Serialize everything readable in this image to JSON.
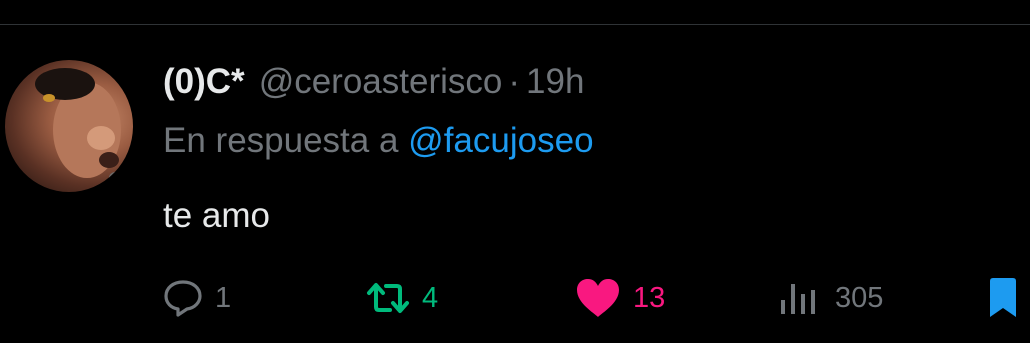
{
  "tweet": {
    "author": {
      "display_name": "(0)C*",
      "handle": "@ceroasterisco",
      "avatar_icon": "profile-photo"
    },
    "separator": "·",
    "time": "19h",
    "reply_to": {
      "prefix": "En respuesta a",
      "mention": "@facujoseo"
    },
    "text": "te amo",
    "actions": {
      "reply": {
        "icon": "reply-bubble-icon",
        "count": "1"
      },
      "retweet": {
        "icon": "retweet-icon",
        "count": "4",
        "active": true
      },
      "like": {
        "icon": "heart-icon",
        "count": "13",
        "active": true
      },
      "views": {
        "icon": "views-bars-icon",
        "count": "305"
      },
      "bookmark": {
        "icon": "bookmark-icon",
        "active": true
      }
    }
  },
  "colors": {
    "background": "#000000",
    "text_primary": "#e7e9ea",
    "text_secondary": "#71767b",
    "mention": "#1d9bf0",
    "retweet_active": "#00ba7c",
    "like_active": "#f91880",
    "bookmark_active": "#1d9bf0",
    "divider": "#2f3336"
  }
}
